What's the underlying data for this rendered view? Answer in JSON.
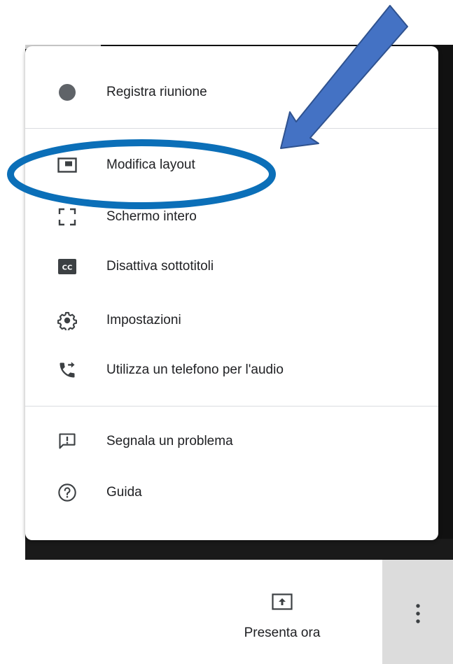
{
  "menu": {
    "items": [
      {
        "label": "Registra riunione",
        "icon": "record-dot-icon"
      },
      {
        "label": "Modifica layout",
        "icon": "layout-icon"
      },
      {
        "label": "Schermo intero",
        "icon": "fullscreen-icon"
      },
      {
        "label": "Disattiva sottotitoli",
        "icon": "closed-captions-icon"
      },
      {
        "label": "Impostazioni",
        "icon": "gear-icon"
      },
      {
        "label": "Utilizza un telefono per l'audio",
        "icon": "phone-forward-icon"
      },
      {
        "label": "Segnala un problema",
        "icon": "feedback-icon"
      },
      {
        "label": "Guida",
        "icon": "help-icon"
      }
    ]
  },
  "footer": {
    "present_label": "Presenta ora"
  },
  "colors": {
    "annotation_blue": "#0b6fb8",
    "arrow_fill": "#4472c4",
    "arrow_stroke": "#2f528f",
    "icon_gray": "#5f6368",
    "record_dot": "#5f6368"
  }
}
